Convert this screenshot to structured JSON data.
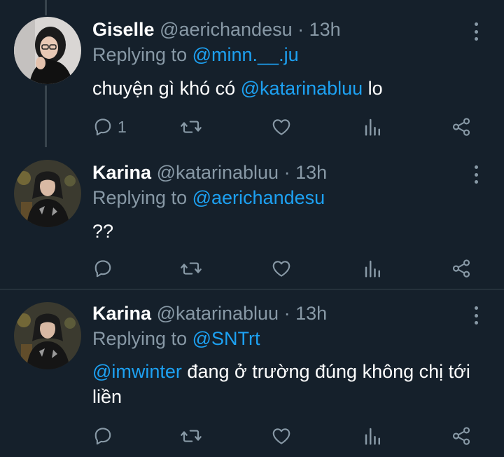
{
  "colors": {
    "background": "#15202b",
    "text": "#ffffff",
    "secondary": "#8899a6",
    "accent": "#1da1f2",
    "divider": "#38444d"
  },
  "tweets": [
    {
      "name": "Giselle",
      "handle": "@aerichandesu",
      "separator": "·",
      "time": "13h",
      "replying_prefix": "Replying to",
      "replying_to": "@minn.__.ju",
      "body_before": "chuyện gì khó có ",
      "body_mention": "@katarinabluu",
      "body_after": " lo",
      "reply_count": "1",
      "avatar_icon": "avatar-giselle"
    },
    {
      "name": "Karina",
      "handle": "@katarinabluu",
      "separator": "·",
      "time": "13h",
      "replying_prefix": "Replying to",
      "replying_to": "@aerichandesu",
      "body_before": "??",
      "body_mention": "",
      "body_after": "",
      "reply_count": "",
      "avatar_icon": "avatar-karina"
    },
    {
      "name": "Karina",
      "handle": "@katarinabluu",
      "separator": "·",
      "time": "13h",
      "replying_prefix": "Replying to",
      "replying_to": "@SNTrt",
      "body_before": "",
      "body_mention": "@imwinter",
      "body_after": " đang ở trường đúng không chị tới liền",
      "reply_count": "",
      "avatar_icon": "avatar-karina"
    }
  ],
  "action_icons": [
    "reply-icon",
    "retweet-icon",
    "like-icon",
    "analytics-icon",
    "share-icon"
  ]
}
